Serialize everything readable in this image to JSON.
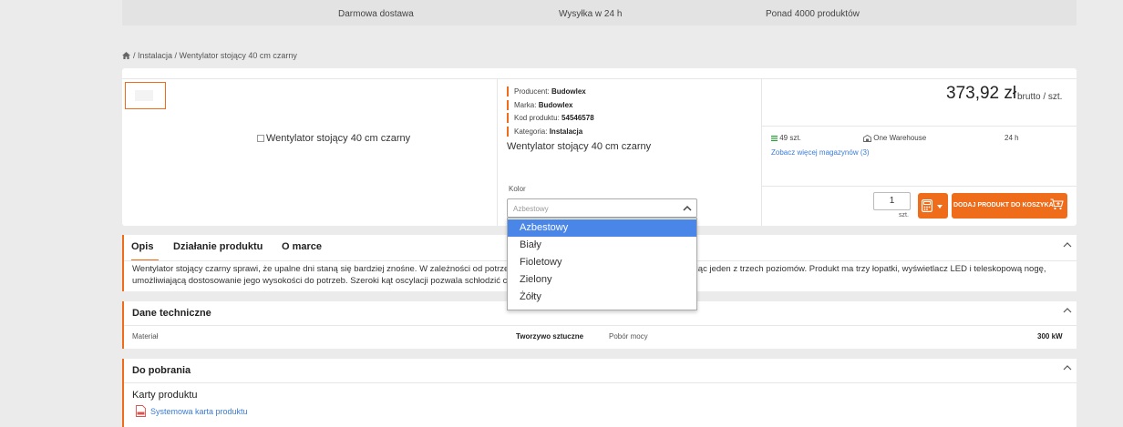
{
  "topbar": {
    "features": [
      "Darmowa dostawa",
      "Wysyłka w 24 h",
      "Ponad 4000 produktów"
    ]
  },
  "breadcrumb": {
    "home_icon": "home-icon",
    "text": "/ Instalacja / Wentylator stojący 40 cm czarny"
  },
  "product": {
    "image_alt": "Wentylator stojący 40 cm czarny",
    "producer_label": "Producent:",
    "producer": "Budowlex",
    "brand_label": "Marka:",
    "brand": "Budowlex",
    "code_label": "Kod produktu:",
    "code": "54546578",
    "category_label": "Kategoria:",
    "category": "Instalacja",
    "title": "Wentylator stojący 40 cm czarny",
    "color_label": "Kolor",
    "color_selected": "Azbestowy",
    "color_options": [
      "Azbestowy",
      "Biały",
      "Fioletowy",
      "Zielony",
      "Żółty"
    ],
    "price": "373,92 zł",
    "price_suffix": "brutto / szt."
  },
  "stock": {
    "qty": "49 szt.",
    "warehouse": "One Warehouse",
    "shipping": "24 h",
    "more_link": "Zobacz więcej magazynów (3)"
  },
  "cart": {
    "quantity": "1",
    "unit": "szt.",
    "add_label": "DODAJ PRODUKT DO KOSZYKA"
  },
  "tabs": {
    "items": [
      "Opis",
      "Działanie produktu",
      "O marce"
    ],
    "description": "Wentylator stojący czarny sprawi, że upalne dni staną się bardziej znośne. W zależności od potrzeb możesz regulować prędkość nawiewu, wybierając jeden z trzech poziomów. Produkt ma trzy łopatki, wyświetlacz LED i teleskopową nogę, umożliwiającą dostosowanie jego wysokości do potrzeb. Szeroki kąt oscylacji pozwala schłodzić całe pomieszczenie."
  },
  "tech": {
    "title": "Dane techniczne",
    "material_label": "Materiał",
    "material_value": "Tworzywo sztuczne",
    "power_label": "Pobór mocy",
    "power_value": "300 kW"
  },
  "downloads": {
    "title": "Do pobrania",
    "subtitle": "Karty produktu",
    "link": "Systemowa karta produktu"
  },
  "colors": {
    "accent": "#ee6c1a",
    "link": "#3a7bd5",
    "selected_option": "#4a86e8"
  }
}
